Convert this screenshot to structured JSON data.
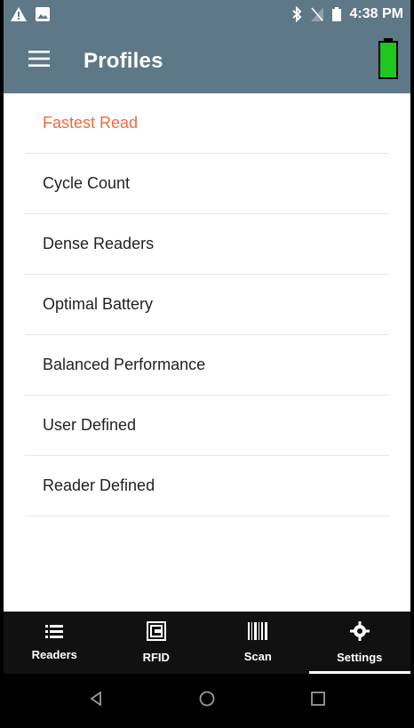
{
  "status_bar": {
    "time": "4:38 PM",
    "icons": [
      "warning-icon",
      "image-icon",
      "bluetooth-icon",
      "no-sim-icon",
      "battery-icon"
    ]
  },
  "app_bar": {
    "title": "Profiles",
    "menu_icon": "menu-icon",
    "battery_color": "#1ec81e"
  },
  "profiles": {
    "items": [
      {
        "label": "Fastest Read",
        "active": true
      },
      {
        "label": "Cycle Count"
      },
      {
        "label": "Dense Readers"
      },
      {
        "label": "Optimal Battery"
      },
      {
        "label": "Balanced Performance"
      },
      {
        "label": "User Defined"
      },
      {
        "label": "Reader Defined"
      }
    ]
  },
  "bottom_nav": {
    "tabs": [
      {
        "label": "Readers",
        "icon": "list-icon"
      },
      {
        "label": "RFID",
        "icon": "rfid-icon"
      },
      {
        "label": "Scan",
        "icon": "barcode-icon"
      },
      {
        "label": "Settings",
        "icon": "gear-icon",
        "active": true
      }
    ]
  },
  "colors": {
    "header": "#5e7888",
    "active_item": "#f26a3f",
    "nav_bg": "#111111"
  }
}
